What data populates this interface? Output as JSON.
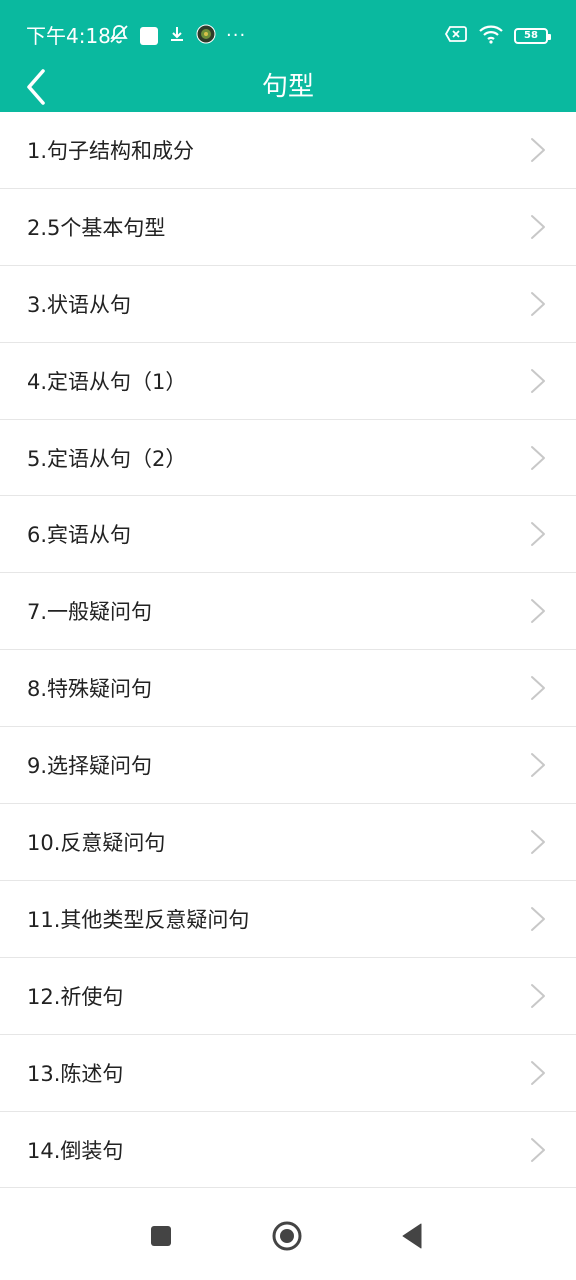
{
  "status_bar": {
    "time": "下午4:18",
    "battery": "58"
  },
  "app_bar": {
    "title": "句型"
  },
  "list": {
    "items": [
      {
        "label": "1.句子结构和成分"
      },
      {
        "label": "2.5个基本句型"
      },
      {
        "label": "3.状语从句"
      },
      {
        "label": "4.定语从句（1）"
      },
      {
        "label": "5.定语从句（2）"
      },
      {
        "label": "6.宾语从句"
      },
      {
        "label": "7.一般疑问句"
      },
      {
        "label": "8.特殊疑问句"
      },
      {
        "label": "9.选择疑问句"
      },
      {
        "label": "10.反意疑问句"
      },
      {
        "label": "11.其他类型反意疑问句"
      },
      {
        "label": "12.祈使句"
      },
      {
        "label": "13.陈述句"
      },
      {
        "label": "14.倒装句"
      }
    ]
  },
  "theme": {
    "accent": "#0ab99f"
  }
}
